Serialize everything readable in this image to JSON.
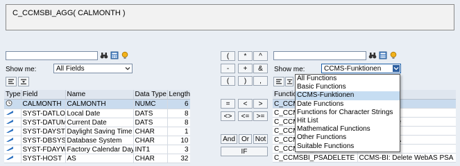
{
  "formula": {
    "text": "C_CCMSBI_AGG( CALMONTH )"
  },
  "left_panel": {
    "show_me_label": "Show me:",
    "filter_value": "All Fields",
    "columns": [
      "Type",
      "Field",
      "Name",
      "Data Type",
      "Length"
    ],
    "rows": [
      {
        "type_icon": "clock-icon",
        "field": "CALMONTH",
        "name": "CALMONTH",
        "data_type": "NUMC",
        "length": "6"
      },
      {
        "type_icon": "field-icon",
        "field": "SYST-DATLO",
        "name": "Local Date",
        "data_type": "DATS",
        "length": "8"
      },
      {
        "type_icon": "field-icon",
        "field": "SYST-DATUM",
        "name": "Current Date",
        "data_type": "DATS",
        "length": "8"
      },
      {
        "type_icon": "field-icon",
        "field": "SYST-DAYST",
        "name": "Daylight Saving Time",
        "data_type": "CHAR",
        "length": "1"
      },
      {
        "type_icon": "field-icon",
        "field": "SYST-DBSYS",
        "name": "Database System",
        "data_type": "CHAR",
        "length": "10"
      },
      {
        "type_icon": "field-icon",
        "field": "SYST-FDAYW",
        "name": "Factory Calendar Day",
        "data_type": "INT1",
        "length": "3"
      },
      {
        "type_icon": "field-icon",
        "field": "SYST-HOST",
        "name": "AS",
        "data_type": "CHAR",
        "length": "32"
      }
    ]
  },
  "operators": {
    "row1": [
      "(",
      "*",
      "^"
    ],
    "row2": [
      "-",
      "+",
      "&"
    ],
    "row3": [
      "(",
      ")",
      ","
    ],
    "row4": [
      "=",
      "<",
      ">"
    ],
    "row5": [
      "<>",
      "<=",
      ">="
    ],
    "row6": [
      "And",
      "Or",
      "Not"
    ],
    "row7": [
      "IF"
    ]
  },
  "right_panel": {
    "show_me_label": "Show me:",
    "filter_value": "CCMS-Funktionen",
    "columns": [
      "Function"
    ],
    "rows": [
      {
        "icon": "function-icon",
        "function": "C_CCMSBI_...",
        "description": "e aggregates"
      },
      {
        "icon": "function-icon",
        "function": "C_CCMSBI_...",
        "description": "e DSO"
      },
      {
        "icon": "function-icon",
        "function": "C_CCMSBI_...",
        "description": "te DSR aggre"
      },
      {
        "icon": "function-icon",
        "function": "C_CCMSBI_...",
        "description": "te DSR DSO"
      },
      {
        "icon": "function-icon",
        "function": "C_CCMSBI_...",
        "description": "ete DSR PSA"
      },
      {
        "icon": "function-icon",
        "function": "C_CCMSBI_...",
        "description": "DSO"
      },
      {
        "icon": "function-icon",
        "function": "C_CCMSBI_PSADELETE",
        "description": "CCMS-BI: Delete WebAS PSA"
      }
    ],
    "dropdown_options": [
      "All Functions",
      "Basic Functions",
      "CCMS-Funktionen",
      "Date Functions",
      "Functions for Character Strings",
      "Hit List",
      "Mathematical Functions",
      "Other Functions",
      "Suitable Functions"
    ],
    "dropdown_highlight": "CCMS-Funktionen"
  },
  "colors": {
    "background": "#e9eef4",
    "header_row": "#dfe6ef",
    "selected_row": "#c9dbee",
    "dropdown_highlight": "#c6ddf2",
    "icon_blue": "#2a6fbf"
  }
}
